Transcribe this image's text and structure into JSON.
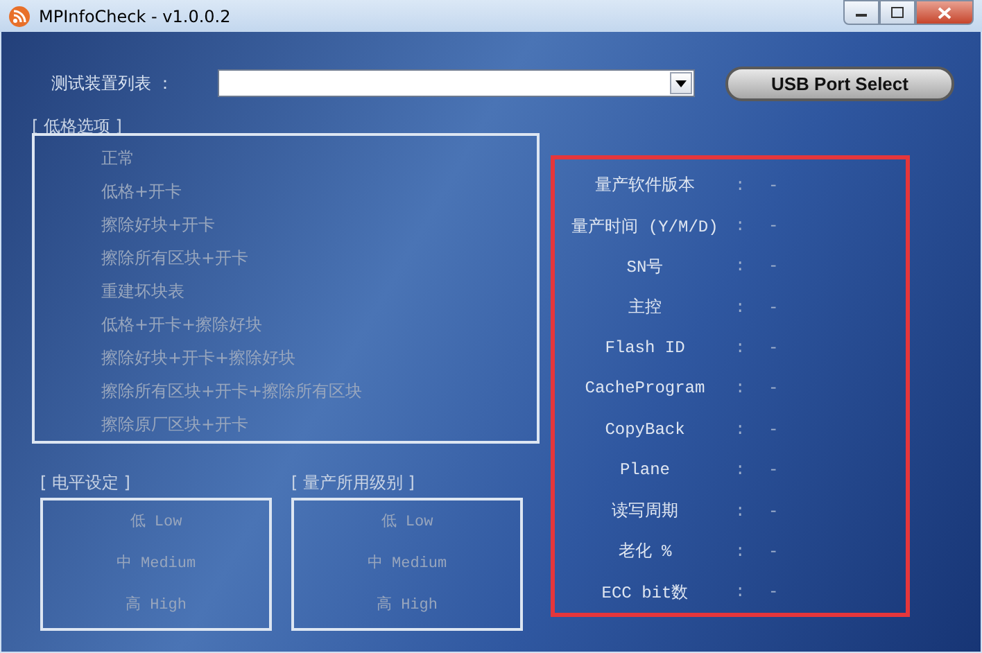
{
  "window": {
    "title": "MPInfoCheck - v1.0.0.2"
  },
  "device_list": {
    "label": "测试装置列表 ："
  },
  "usb_button": {
    "label": "USB Port Select"
  },
  "format_options": {
    "title": "[ 低格选项 ]",
    "items": [
      {
        "label": "正常",
        "disabled": true
      },
      {
        "label": "低格+开卡",
        "disabled": true
      },
      {
        "label": "擦除好块+开卡",
        "disabled": true
      },
      {
        "label": "擦除所有区块+开卡",
        "disabled": true
      },
      {
        "label": "重建坏块表",
        "disabled": true
      },
      {
        "label": "低格+开卡+擦除好块",
        "disabled": true
      },
      {
        "label": "擦除好块+开卡+擦除好块",
        "disabled": true
      },
      {
        "label": "擦除所有区块+开卡+擦除所有区块",
        "disabled": true
      },
      {
        "label": "擦除原厂区块+开卡",
        "disabled": true
      }
    ]
  },
  "level_setting": {
    "title": "[ 电平设定 ]",
    "items": [
      {
        "label": "低 Low",
        "disabled": true
      },
      {
        "label": "中 Medium",
        "disabled": true
      },
      {
        "label": "高 High",
        "disabled": true
      }
    ]
  },
  "production_level": {
    "title": "[ 量产所用级别 ]",
    "items": [
      {
        "label": "低 Low",
        "disabled": true
      },
      {
        "label": "中 Medium",
        "disabled": true
      },
      {
        "label": "高 High",
        "disabled": true
      }
    ]
  },
  "info": [
    {
      "label": "量产软件版本",
      "colon": ":",
      "value": "-"
    },
    {
      "label": "量产时间 (Y/M/D)",
      "colon": ":",
      "value": "-"
    },
    {
      "label": "SN号",
      "colon": ":",
      "value": "-"
    },
    {
      "label": "主控",
      "colon": ":",
      "value": "-"
    },
    {
      "label": "Flash ID",
      "colon": ":",
      "value": "-"
    },
    {
      "label": "CacheProgram",
      "colon": ":",
      "value": "-"
    },
    {
      "label": "CopyBack",
      "colon": ":",
      "value": "-"
    },
    {
      "label": "Plane",
      "colon": ":",
      "value": "-"
    },
    {
      "label": "读写周期",
      "colon": ":",
      "value": "-"
    },
    {
      "label": "老化 %",
      "colon": ":",
      "value": "-"
    },
    {
      "label": "ECC bit数",
      "colon": ":",
      "value": "-"
    }
  ]
}
